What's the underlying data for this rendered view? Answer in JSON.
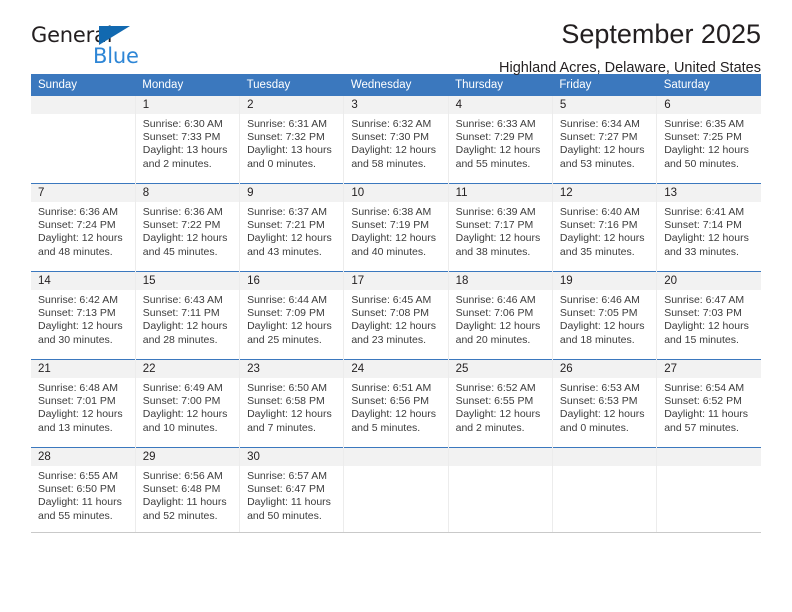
{
  "brand": {
    "name_part1": "General",
    "name_part2": "Blue",
    "triangle_color": "#1269b0",
    "blue_color": "#2e86d6"
  },
  "header": {
    "title": "September 2025",
    "subtitle": "Highland Acres, Delaware, United States"
  },
  "theme": {
    "header_bg": "#3b78be",
    "daynum_bg": "#f2f2f2",
    "rule_color": "#3b78be"
  },
  "weekday_headers": [
    "Sunday",
    "Monday",
    "Tuesday",
    "Wednesday",
    "Thursday",
    "Friday",
    "Saturday"
  ],
  "weeks": [
    [
      {
        "day": "",
        "sunrise": "",
        "sunset": "",
        "daylight1": "",
        "daylight2": ""
      },
      {
        "day": "1",
        "sunrise": "Sunrise: 6:30 AM",
        "sunset": "Sunset: 7:33 PM",
        "daylight1": "Daylight: 13 hours",
        "daylight2": "and 2 minutes."
      },
      {
        "day": "2",
        "sunrise": "Sunrise: 6:31 AM",
        "sunset": "Sunset: 7:32 PM",
        "daylight1": "Daylight: 13 hours",
        "daylight2": "and 0 minutes."
      },
      {
        "day": "3",
        "sunrise": "Sunrise: 6:32 AM",
        "sunset": "Sunset: 7:30 PM",
        "daylight1": "Daylight: 12 hours",
        "daylight2": "and 58 minutes."
      },
      {
        "day": "4",
        "sunrise": "Sunrise: 6:33 AM",
        "sunset": "Sunset: 7:29 PM",
        "daylight1": "Daylight: 12 hours",
        "daylight2": "and 55 minutes."
      },
      {
        "day": "5",
        "sunrise": "Sunrise: 6:34 AM",
        "sunset": "Sunset: 7:27 PM",
        "daylight1": "Daylight: 12 hours",
        "daylight2": "and 53 minutes."
      },
      {
        "day": "6",
        "sunrise": "Sunrise: 6:35 AM",
        "sunset": "Sunset: 7:25 PM",
        "daylight1": "Daylight: 12 hours",
        "daylight2": "and 50 minutes."
      }
    ],
    [
      {
        "day": "7",
        "sunrise": "Sunrise: 6:36 AM",
        "sunset": "Sunset: 7:24 PM",
        "daylight1": "Daylight: 12 hours",
        "daylight2": "and 48 minutes."
      },
      {
        "day": "8",
        "sunrise": "Sunrise: 6:36 AM",
        "sunset": "Sunset: 7:22 PM",
        "daylight1": "Daylight: 12 hours",
        "daylight2": "and 45 minutes."
      },
      {
        "day": "9",
        "sunrise": "Sunrise: 6:37 AM",
        "sunset": "Sunset: 7:21 PM",
        "daylight1": "Daylight: 12 hours",
        "daylight2": "and 43 minutes."
      },
      {
        "day": "10",
        "sunrise": "Sunrise: 6:38 AM",
        "sunset": "Sunset: 7:19 PM",
        "daylight1": "Daylight: 12 hours",
        "daylight2": "and 40 minutes."
      },
      {
        "day": "11",
        "sunrise": "Sunrise: 6:39 AM",
        "sunset": "Sunset: 7:17 PM",
        "daylight1": "Daylight: 12 hours",
        "daylight2": "and 38 minutes."
      },
      {
        "day": "12",
        "sunrise": "Sunrise: 6:40 AM",
        "sunset": "Sunset: 7:16 PM",
        "daylight1": "Daylight: 12 hours",
        "daylight2": "and 35 minutes."
      },
      {
        "day": "13",
        "sunrise": "Sunrise: 6:41 AM",
        "sunset": "Sunset: 7:14 PM",
        "daylight1": "Daylight: 12 hours",
        "daylight2": "and 33 minutes."
      }
    ],
    [
      {
        "day": "14",
        "sunrise": "Sunrise: 6:42 AM",
        "sunset": "Sunset: 7:13 PM",
        "daylight1": "Daylight: 12 hours",
        "daylight2": "and 30 minutes."
      },
      {
        "day": "15",
        "sunrise": "Sunrise: 6:43 AM",
        "sunset": "Sunset: 7:11 PM",
        "daylight1": "Daylight: 12 hours",
        "daylight2": "and 28 minutes."
      },
      {
        "day": "16",
        "sunrise": "Sunrise: 6:44 AM",
        "sunset": "Sunset: 7:09 PM",
        "daylight1": "Daylight: 12 hours",
        "daylight2": "and 25 minutes."
      },
      {
        "day": "17",
        "sunrise": "Sunrise: 6:45 AM",
        "sunset": "Sunset: 7:08 PM",
        "daylight1": "Daylight: 12 hours",
        "daylight2": "and 23 minutes."
      },
      {
        "day": "18",
        "sunrise": "Sunrise: 6:46 AM",
        "sunset": "Sunset: 7:06 PM",
        "daylight1": "Daylight: 12 hours",
        "daylight2": "and 20 minutes."
      },
      {
        "day": "19",
        "sunrise": "Sunrise: 6:46 AM",
        "sunset": "Sunset: 7:05 PM",
        "daylight1": "Daylight: 12 hours",
        "daylight2": "and 18 minutes."
      },
      {
        "day": "20",
        "sunrise": "Sunrise: 6:47 AM",
        "sunset": "Sunset: 7:03 PM",
        "daylight1": "Daylight: 12 hours",
        "daylight2": "and 15 minutes."
      }
    ],
    [
      {
        "day": "21",
        "sunrise": "Sunrise: 6:48 AM",
        "sunset": "Sunset: 7:01 PM",
        "daylight1": "Daylight: 12 hours",
        "daylight2": "and 13 minutes."
      },
      {
        "day": "22",
        "sunrise": "Sunrise: 6:49 AM",
        "sunset": "Sunset: 7:00 PM",
        "daylight1": "Daylight: 12 hours",
        "daylight2": "and 10 minutes."
      },
      {
        "day": "23",
        "sunrise": "Sunrise: 6:50 AM",
        "sunset": "Sunset: 6:58 PM",
        "daylight1": "Daylight: 12 hours",
        "daylight2": "and 7 minutes."
      },
      {
        "day": "24",
        "sunrise": "Sunrise: 6:51 AM",
        "sunset": "Sunset: 6:56 PM",
        "daylight1": "Daylight: 12 hours",
        "daylight2": "and 5 minutes."
      },
      {
        "day": "25",
        "sunrise": "Sunrise: 6:52 AM",
        "sunset": "Sunset: 6:55 PM",
        "daylight1": "Daylight: 12 hours",
        "daylight2": "and 2 minutes."
      },
      {
        "day": "26",
        "sunrise": "Sunrise: 6:53 AM",
        "sunset": "Sunset: 6:53 PM",
        "daylight1": "Daylight: 12 hours",
        "daylight2": "and 0 minutes."
      },
      {
        "day": "27",
        "sunrise": "Sunrise: 6:54 AM",
        "sunset": "Sunset: 6:52 PM",
        "daylight1": "Daylight: 11 hours",
        "daylight2": "and 57 minutes."
      }
    ],
    [
      {
        "day": "28",
        "sunrise": "Sunrise: 6:55 AM",
        "sunset": "Sunset: 6:50 PM",
        "daylight1": "Daylight: 11 hours",
        "daylight2": "and 55 minutes."
      },
      {
        "day": "29",
        "sunrise": "Sunrise: 6:56 AM",
        "sunset": "Sunset: 6:48 PM",
        "daylight1": "Daylight: 11 hours",
        "daylight2": "and 52 minutes."
      },
      {
        "day": "30",
        "sunrise": "Sunrise: 6:57 AM",
        "sunset": "Sunset: 6:47 PM",
        "daylight1": "Daylight: 11 hours",
        "daylight2": "and 50 minutes."
      },
      {
        "day": "",
        "sunrise": "",
        "sunset": "",
        "daylight1": "",
        "daylight2": ""
      },
      {
        "day": "",
        "sunrise": "",
        "sunset": "",
        "daylight1": "",
        "daylight2": ""
      },
      {
        "day": "",
        "sunrise": "",
        "sunset": "",
        "daylight1": "",
        "daylight2": ""
      },
      {
        "day": "",
        "sunrise": "",
        "sunset": "",
        "daylight1": "",
        "daylight2": ""
      }
    ]
  ]
}
